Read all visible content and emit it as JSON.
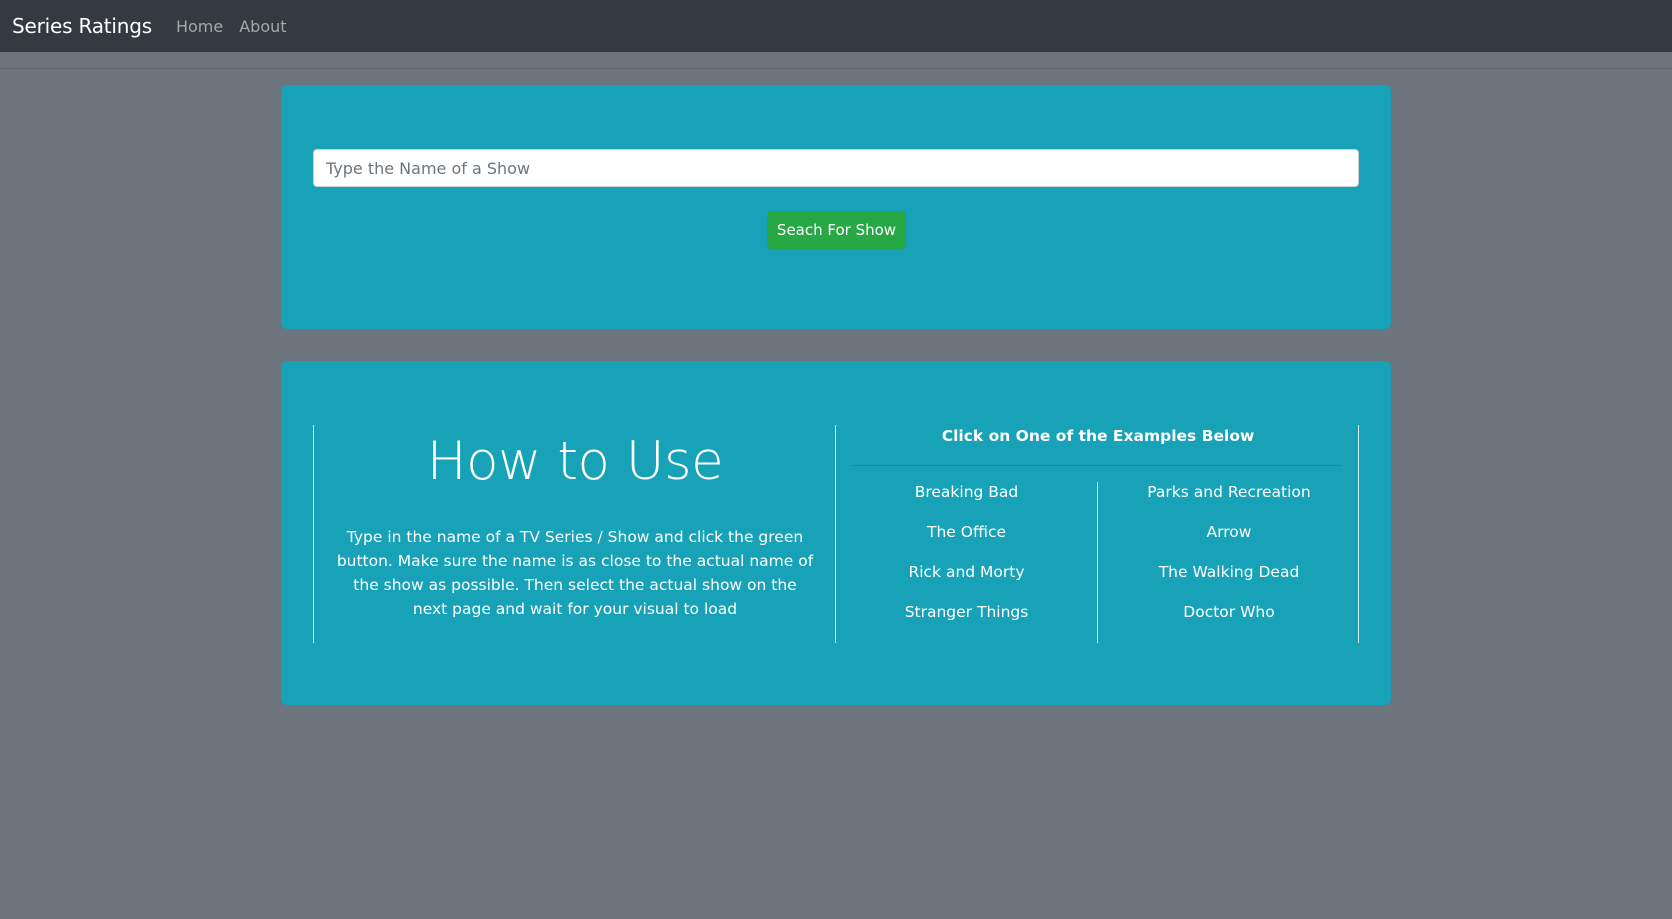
{
  "navbar": {
    "brand": "Series Ratings",
    "links": [
      "Home",
      "About"
    ]
  },
  "search": {
    "placeholder": "Type the Name of a Show",
    "value": "",
    "button_label": "Seach For Show"
  },
  "howto": {
    "title": "How to Use",
    "text": "Type in the name of a TV Series / Show and click the green button. Make sure the name is as close to the actual name of the show as possible. Then select the actual show on the next page and wait for your visual to load"
  },
  "examples": {
    "heading": "Click on One of the Examples Below",
    "left": [
      "Breaking Bad",
      "The Office",
      "Rick and Morty",
      "Stranger Things"
    ],
    "right": [
      "Parks and Recreation",
      "Arrow",
      "The Walking Dead",
      "Doctor Who"
    ]
  },
  "colors": {
    "navbar": "#343a40",
    "page_background": "#6c757d",
    "card": "#17a2b8",
    "button": "#28a745"
  }
}
